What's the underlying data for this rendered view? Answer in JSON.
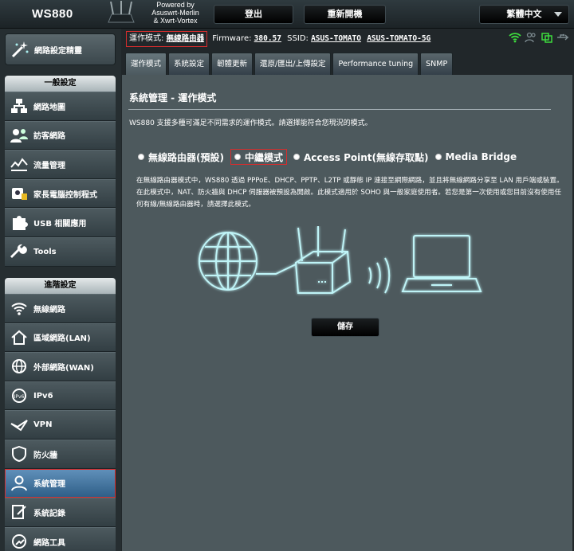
{
  "header": {
    "model": "WS880",
    "powered_by": [
      "Powered by",
      "Asuswrt-Merlin",
      "& Xwrt-Vortex"
    ],
    "logout_label": "登出",
    "reboot_label": "重新開機",
    "language_label": "繁體中文"
  },
  "sidebar": {
    "qis_label": "網路設定精靈",
    "general_header": "一般設定",
    "general_items": [
      {
        "label": "網路地圖",
        "icon": "network-map-icon"
      },
      {
        "label": "訪客網路",
        "icon": "guest-network-icon"
      },
      {
        "label": "流量管理",
        "icon": "traffic-manager-icon"
      },
      {
        "label": "家長電腦控制程式",
        "icon": "parental-control-icon"
      },
      {
        "label": "USB 相關應用",
        "icon": "usb-puzzle-icon"
      },
      {
        "label": "Tools",
        "icon": "wrench-icon"
      }
    ],
    "advanced_header": "進階設定",
    "advanced_items": [
      {
        "label": "無線網路",
        "icon": "wifi-icon"
      },
      {
        "label": "區域網路(LAN)",
        "icon": "house-icon"
      },
      {
        "label": "外部網路(WAN)",
        "icon": "globe-icon"
      },
      {
        "label": "IPv6",
        "icon": "ipv6-icon"
      },
      {
        "label": "VPN",
        "icon": "vpn-icon"
      },
      {
        "label": "防火牆",
        "icon": "shield-icon"
      },
      {
        "label": "系統管理",
        "icon": "admin-icon"
      },
      {
        "label": "系統記錄",
        "icon": "log-icon"
      },
      {
        "label": "網路工具",
        "icon": "network-tools-icon"
      }
    ]
  },
  "status": {
    "op_mode_label": "運作模式:",
    "op_mode_value": "無線路由器",
    "firmware_label": "Firmware:",
    "firmware_value": "380.57",
    "ssid_label": "SSID:",
    "ssid_1": "ASUS-TOMATO",
    "ssid_2": "ASUS-TOMATO-5G"
  },
  "tabs": [
    "運作模式",
    "系統設定",
    "韌體更新",
    "還原/匯出/上傳設定",
    "Performance tuning",
    "SNMP"
  ],
  "main": {
    "title": "系統管理 - 運作模式",
    "description": "WS880 支援多種可滿足不同需求的運作模式。請選擇能符合您現況的模式。",
    "modes": [
      "無線路由器(預設)",
      "中繼模式",
      "Access Point(無線存取點)",
      "Media Bridge"
    ],
    "mode_description": "在無線路由器模式中，WS880 透過 PPPoE、DHCP、PPTP、L2TP 或靜態 IP 連接至網際網路，並且將無線網路分享至 LAN 用戶端或裝置。在此模式中，NAT、防火牆與 DHCP 伺服器被預設為開啟。此模式適用於 SOHO 與一般家庭使用者。若您是第一次使用或您目前沒有使用任何有線/無線路由器時，請選擇此模式。",
    "save_label": "儲存"
  },
  "colors": {
    "panel_bg": "#4d595d",
    "accent_highlight": "#d62d2d",
    "illustration_glow": "#7fe0e8",
    "status_green": "#3ddc3d"
  }
}
